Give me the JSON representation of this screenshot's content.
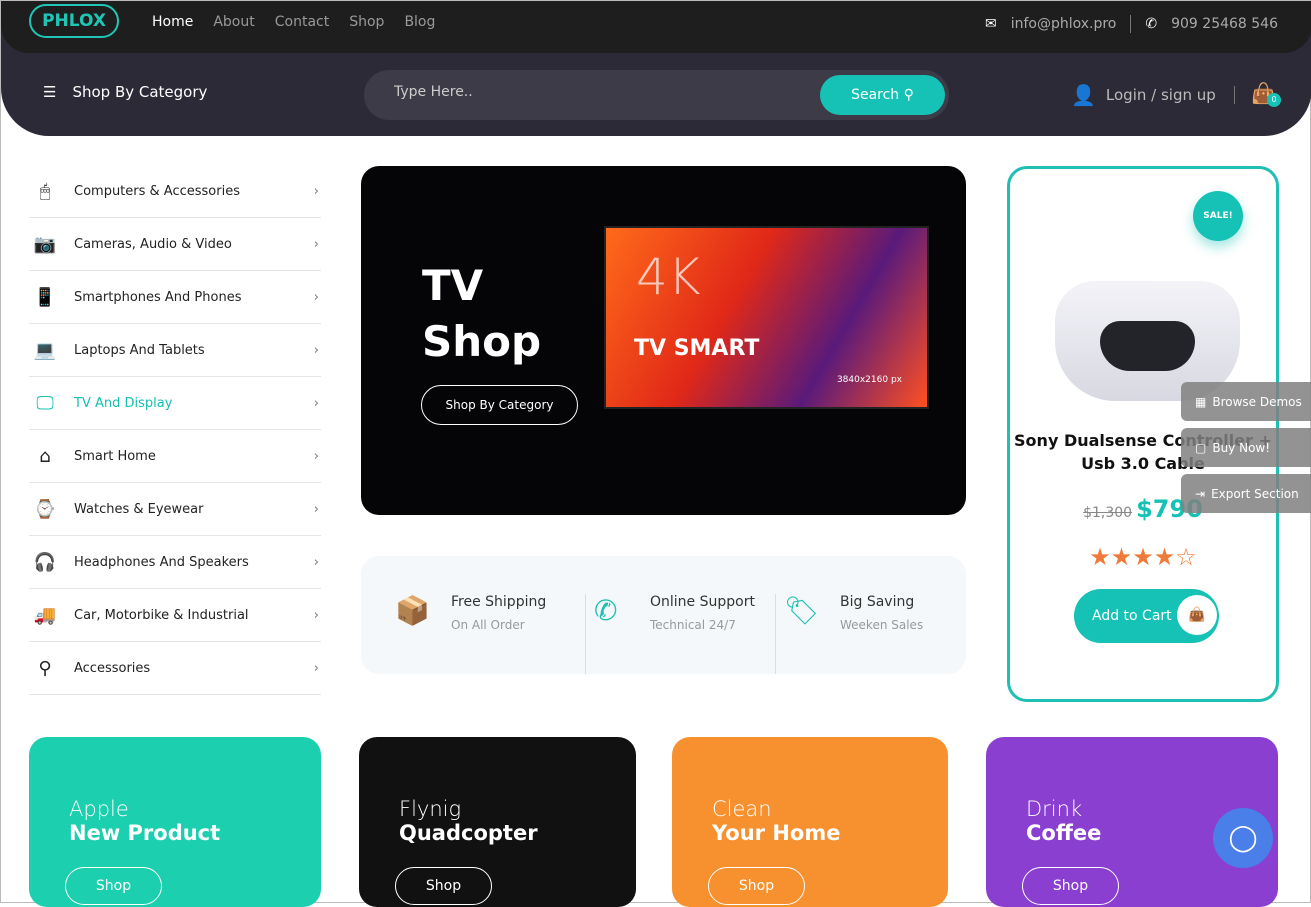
{
  "header": {
    "logo": "PHLOX",
    "nav": [
      "Home",
      "About",
      "Contact",
      "Shop",
      "Blog"
    ],
    "email": "info@phlox.pro",
    "phone": "909 25468 546",
    "category_label": "Shop By Category",
    "search_placeholder": "Type Here..",
    "search_button": "Search",
    "login": "Login / sign up",
    "cart_count": "0"
  },
  "sidebar": {
    "items": [
      {
        "label": "Computers & Accessories",
        "icon": "mouse-icon",
        "glyph": "🖱"
      },
      {
        "label": "Cameras, Audio & Video",
        "icon": "camera-icon",
        "glyph": "📷"
      },
      {
        "label": "Smartphones And Phones",
        "icon": "smartphone-icon",
        "glyph": "📱"
      },
      {
        "label": "Laptops And Tablets",
        "icon": "laptop-icon",
        "glyph": "💻"
      },
      {
        "label": "TV And Display",
        "icon": "monitor-icon",
        "glyph": "🖵",
        "active": true
      },
      {
        "label": "Smart Home",
        "icon": "home-icon",
        "glyph": "⌂"
      },
      {
        "label": "Watches & Eyewear",
        "icon": "watch-icon",
        "glyph": "⌚"
      },
      {
        "label": "Headphones And Speakers",
        "icon": "headphones-icon",
        "glyph": "🎧"
      },
      {
        "label": "Car, Motorbike & Industrial",
        "icon": "truck-icon",
        "glyph": "🚚"
      },
      {
        "label": "Accessories",
        "icon": "hierarchy-icon",
        "glyph": "⚲"
      }
    ]
  },
  "hero": {
    "title_line1": "TV",
    "title_line2": "Shop",
    "button": "Shop By Category",
    "tv_4k": "4K",
    "tv_smart": "TV SMART",
    "tv_res": "3840x2160 px"
  },
  "features": [
    {
      "title": "Free Shipping",
      "sub": "On All Order"
    },
    {
      "title": "Online Support",
      "sub": "Technical 24/7"
    },
    {
      "title": "Big Saving",
      "sub": "Weeken Sales"
    }
  ],
  "product": {
    "badge": "SALE!",
    "name": "Sony Dualsense Controller + Usb 3.0 Cable",
    "old_price": "$1,300",
    "price": "$790",
    "rating": 4,
    "rating_max": 5,
    "button": "Add to Cart"
  },
  "floating": [
    "Browse Demos",
    "Buy Now!",
    "Export Section"
  ],
  "banners": [
    {
      "line1": "Apple",
      "line2": "New Product",
      "button": "Shop",
      "color": "#1ccfae"
    },
    {
      "line1": "Flynig",
      "line2": "Quadcopter",
      "button": "Shop",
      "color": "#111111"
    },
    {
      "line1": "Clean",
      "line2": "Your Home",
      "button": "Shop",
      "color": "#f7902e"
    },
    {
      "line1": "Drink",
      "line2": "Coffee",
      "button": "Shop",
      "color": "#8a3fd1"
    }
  ],
  "colors": {
    "accent": "#15c2b5",
    "header": "#1e1e1e",
    "subheader": "#2b2a36"
  }
}
